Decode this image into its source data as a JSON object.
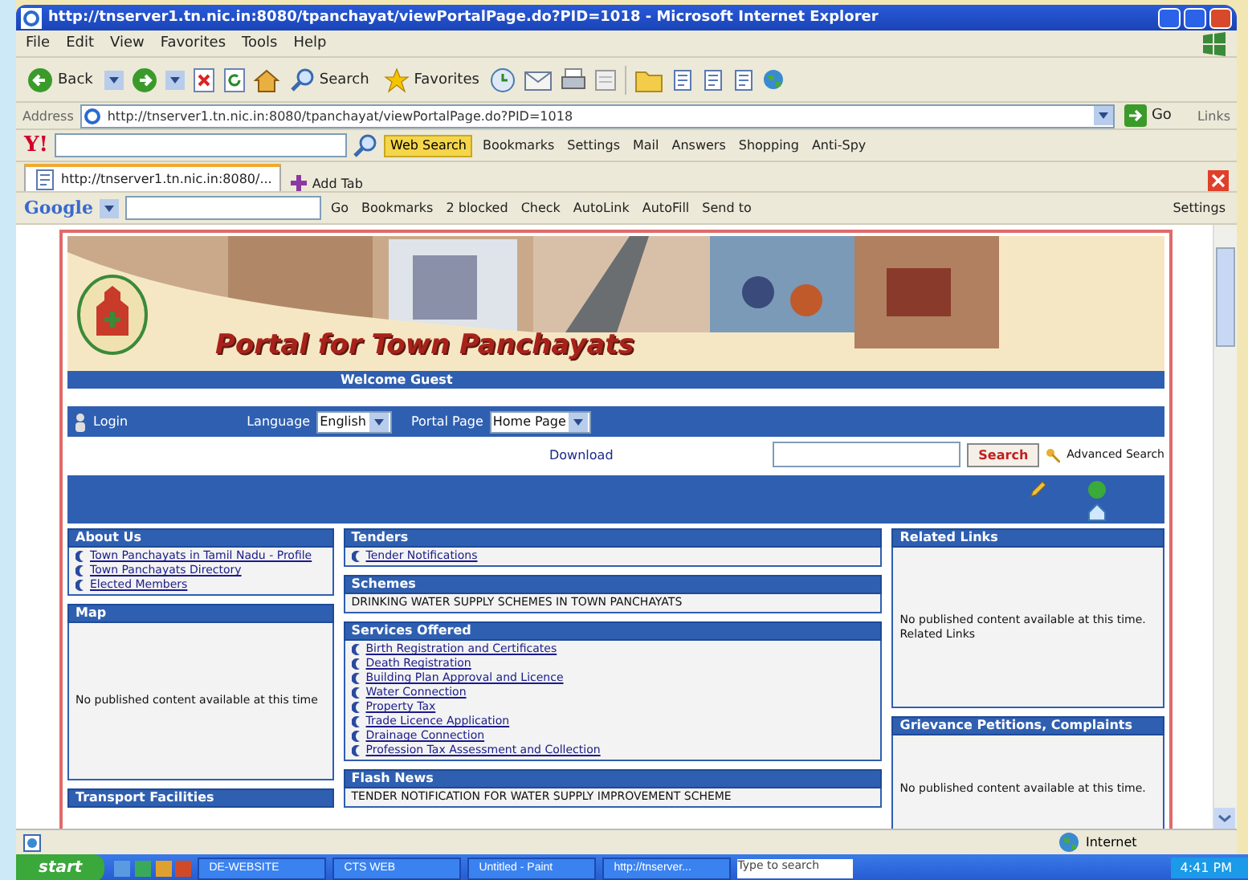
{
  "window": {
    "title": "http://tnserver1.tn.nic.in:8080/tpanchayat/viewPortalPage.do?PID=1018 - Microsoft Internet Explorer"
  },
  "menu": [
    {
      "label": "File"
    },
    {
      "label": "Edit"
    },
    {
      "label": "View"
    },
    {
      "label": "Favorites"
    },
    {
      "label": "Tools"
    },
    {
      "label": "Help"
    }
  ],
  "toolbar": {
    "back": "Back",
    "search": "Search",
    "favorites": "Favorites"
  },
  "address": {
    "label": "Address",
    "value": "http://tnserver1.tn.nic.in:8080/tpanchayat/viewPortalPage.do?PID=1018",
    "go": "Go",
    "links": "Links"
  },
  "yahoo": {
    "logo": "Y!",
    "search_button": "Web Search",
    "items": [
      "Bookmarks",
      "Settings",
      "Mail",
      "Answers",
      "Shopping",
      "Anti-Spy"
    ]
  },
  "tabs": [
    {
      "label": "http://tnserver1.tn.nic.in:8080/...",
      "selected": true
    }
  ],
  "new_tab": "Add Tab",
  "google": {
    "logo": "Google",
    "items": [
      "Go",
      "Bookmarks",
      "2 blocked",
      "Check",
      "AutoLink",
      "AutoFill",
      "Send to",
      "Settings"
    ]
  },
  "portal": {
    "title": "Portal for Town Panchayats",
    "welcome": "Welcome Guest",
    "login": "Login",
    "language_label": "Language",
    "language": "English",
    "page_label": "Portal Page",
    "page": "Home Page",
    "download": "Download",
    "search_button": "Search",
    "advanced_search": "Advanced Search",
    "columns": [
      [
        {
          "title": "About Us",
          "kind": "links",
          "items": [
            "Town Panchayats in Tamil Nadu - Profile",
            "Town Panchayats Directory",
            "Elected Members"
          ]
        },
        {
          "title": "Map",
          "kind": "text",
          "text": "No published content available at this time"
        },
        {
          "title": "Transport Facilities",
          "kind": "header"
        }
      ],
      [
        {
          "title": "Tenders",
          "kind": "links",
          "items": [
            "Tender Notifications"
          ]
        },
        {
          "title": "Schemes",
          "kind": "text",
          "text": "DRINKING WATER SUPPLY SCHEMES IN TOWN PANCHAYATS"
        },
        {
          "title": "Services Offered",
          "kind": "links",
          "items": [
            "Birth Registration and Certificates",
            "Death Registration",
            "Building Plan Approval and Licence",
            "Water Connection",
            "Property Tax",
            "Trade Licence Application",
            "Drainage Connection",
            "Profession Tax Assessment and Collection"
          ]
        },
        {
          "title": "Flash News",
          "kind": "text",
          "text": "TENDER NOTIFICATION FOR WATER SUPPLY IMPROVEMENT SCHEME"
        }
      ],
      [
        {
          "title": "Related Links",
          "kind": "text",
          "text": "No published content available at this time. Related Links"
        },
        {
          "title": "Grievance Petitions, Complaints",
          "kind": "text",
          "text": "No published content available at this time."
        }
      ]
    ]
  },
  "status": {
    "zone": "Internet"
  },
  "taskbar": {
    "start": "start",
    "tasks": [
      "DE-WEBSITE",
      "CTS WEB",
      "Untitled - Paint",
      "http://tnserver..."
    ],
    "search": "Type to search",
    "clock": "4:41 PM"
  }
}
